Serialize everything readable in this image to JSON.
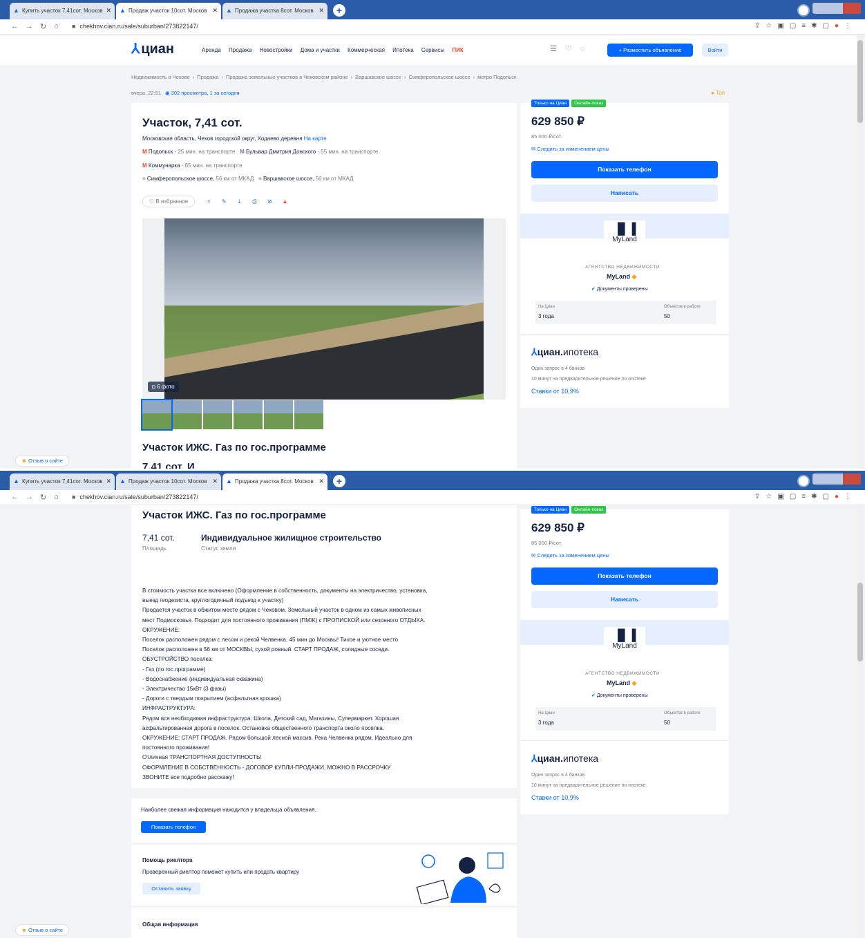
{
  "browser": {
    "tabs": [
      "Купить участок 7,41сот. Москов",
      "Продаж участок 10сот. Москов",
      "Продажа участка 8сот. Москов"
    ],
    "url": "chekhov.cian.ru/sale/suburban/273822147/"
  },
  "header": {
    "logo": "циан",
    "nav": [
      "Аренда",
      "Продажа",
      "Новостройки",
      "Дома и участки",
      "Коммерческая",
      "Ипотека",
      "Сервисы",
      "ПИК"
    ],
    "post_ad": "+ Разместить объявление",
    "login": "Войти"
  },
  "breadcrumbs": [
    "Недвижимость в Чехове",
    "›",
    "Продажа",
    "›",
    "Продажа земельных участков в Чеховском районе",
    "›",
    "Варшавское шоссе",
    "›",
    "Симферопольское шоссе",
    "›",
    "метро Подольск"
  ],
  "meta": {
    "date": "вчера, 22:51",
    "views": "302 просмотра, 1 за сегодня",
    "top": "Топ"
  },
  "listing": {
    "title": "Участок, 7,41 сот.",
    "address": "Московская область, Чехов городской округ, Ходаево деревня",
    "map_link": "На карте",
    "transport": [
      {
        "name": "Подольск",
        "time": "25 мин. на транспорте"
      },
      {
        "name": "Бульвар Дмитрия Донского",
        "time": "55 мин. на транспорте"
      },
      {
        "name": "Коммунарка",
        "time": "65 мин. на транспорте"
      }
    ],
    "highways": [
      {
        "name": "Симферопольское шоссе,",
        "dist": "56 км от МКАД"
      },
      {
        "name": "Варшавское шоссе,",
        "dist": "56 км от МКАД"
      }
    ],
    "favorite": "В избранное",
    "photo_count": "6 фото",
    "subtitle": "Участок ИЖС. Газ по гос.программе",
    "clipped_text": "7,41 сот. И"
  },
  "facts": {
    "area_value": "7,41 сот.",
    "area_label": "Площадь",
    "status_value": "Индивидуальное жилищное строительство",
    "status_label": "Статус земли"
  },
  "description": [
    "В стоимость участка все включено (Оформление в собственность, документы на электричество, установка,",
    "выезд геодезиста, круглогодичный подъезд к участку)",
    "Продается участок в обжитом месте рядом с Чеховом. Земельный участок в одном из самых живописных",
    "мест Подмосковья. Подходит для постоянного проживания (ПМЖ) с ПРОПИСКОЙ или сезонного ОТДЫХА.",
    "ОКРУЖЕНИЕ:",
    "Поселок расположен рядом с лесом и рекой Челвенка. 45 мин до Москвы! Тихое и уютное место",
    "Поселок расположен в 56 км от МОСКВЫ, сухой ровный. СТАРТ ПРОДАЖ, солидные соседи.",
    "ОБУСТРОЙСТВО поселка:",
    "- Газ (по гос.программе)",
    "- Водоснабжение (индивидуальная скважина)",
    "- Электричество 15кВт (3 фазы)",
    "- Дороги с твердым покрытием (асфальтная крошка)",
    "ИНФРАСТРУКТУРА:",
    "Рядом вся необходимая инфраструктура: Школа, Детский сад, Магазины, Супермаркет. Хорошая",
    "асфальтированная дорога в поселок. Остановка общественного транспорта около посёлка.",
    "ОКРУЖЕНИЕ: СТАРТ ПРОДАЖ. Рядом большой лесной массив. Река Челвенка рядом. Идеально для",
    "постоянного проживания!",
    "Отличная ТРАНСПОРТНАЯ ДОСТУПНОСТЬ!",
    "ОФОРМЛЕНИЕ В СОБСТВЕННОСТЬ - ДОГОВОР КУПЛИ-ПРОДАЖИ, МОЖНО В РАССРОЧКУ",
    "ЗВОНИТЕ все подробно расскажу!"
  ],
  "owner_note": "Наиболее свежая информация находится у владельца объявления.",
  "owner_button": "Показать телефон",
  "realtor": {
    "title": "Помощь риелтора",
    "text": "Проверенный риелтор поможет купить или продать квартиру",
    "button": "Оставить заявку"
  },
  "general_info": "Общая информация",
  "sidebar": {
    "badge_cian": "Только на Циан",
    "badge_online": "Онлайн-показ",
    "price": "629 850 ₽",
    "price_per": "85 000 ₽/сот.",
    "follow": "Следить за изменением цены",
    "show_phone": "Показать телефон",
    "write": "Написать",
    "agency_logo": "MyLand",
    "agency_type": "АГЕНТСТВО НЕДВИЖИМОСТИ",
    "agency_name": "MyLand",
    "docs": "Документы проверены",
    "on_cian_label": "На Циан",
    "on_cian_value": "3 года",
    "objects_label": "Объектов в работе",
    "objects_value": "50",
    "mortgage_logo": "циан",
    "mortgage_word": "ипотека",
    "mortgage_t1": "Один запрос в 4 банков",
    "mortgage_t2": "10 минут на предварительное решение по ипотеке",
    "mortgage_rate": "Ставки от 10,9%"
  },
  "feedback": "Отзыв о сайте"
}
